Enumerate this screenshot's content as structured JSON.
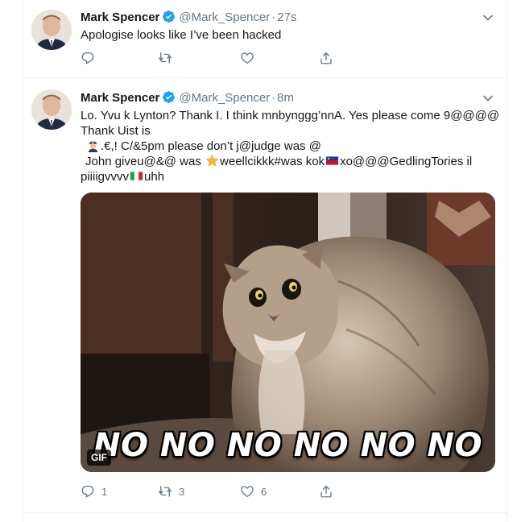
{
  "tweets": [
    {
      "author_name": "Mark Spencer",
      "handle": "@Mark_Spencer",
      "separator": "·",
      "time": "27s",
      "text": "Apologise looks like I’ve been hacked",
      "actions": {
        "reply": "",
        "retweet": "",
        "like": ""
      }
    },
    {
      "author_name": "Mark Spencer",
      "handle": "@Mark_Spencer",
      "separator": "·",
      "time": "8m",
      "text_lines": {
        "l1": "Lo. Yvu k Lynton? Thank I. I think mnbynggg’nnA. Yes please come 9@@@@",
        "l2": "Thank Uist is",
        "l3": ".€,!   C/&5pm please don’t j@judge was @",
        "l4a": "John giveu@&@ was ",
        "l4b": "weellcikkk#was kok",
        "l4c": "xo@@@GedlingTories il",
        "l5a": "piiiigvvvv",
        "l5b": "uhh"
      },
      "media": {
        "badge": "GIF",
        "caption": "NO NO NO NO NO NO"
      },
      "actions": {
        "reply": "1",
        "retweet": "3",
        "like": "6"
      }
    }
  ],
  "icons": {
    "verified": "verified-badge-icon",
    "caret": "chevron-down-icon",
    "reply": "reply-icon",
    "retweet": "retweet-icon",
    "like": "heart-icon",
    "share": "share-icon",
    "emoji_1": "police-officer-emoji",
    "emoji_2": "star-emoji",
    "emoji_3": "liechtenstein-flag-emoji",
    "emoji_4": "italy-flag-emoji"
  },
  "colors": {
    "verified": "#1da1f2",
    "muted": "#657786",
    "text": "#14171a",
    "divider": "#e6ecf0"
  }
}
